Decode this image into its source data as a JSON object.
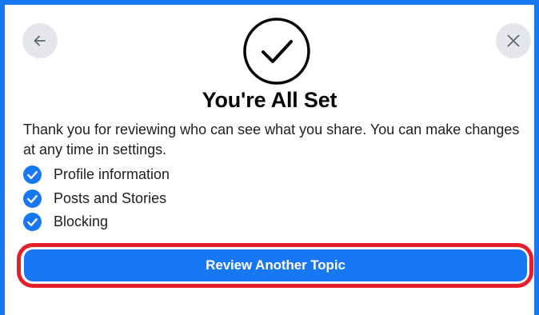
{
  "dialog": {
    "title": "You're All Set",
    "description": "Thank you for reviewing who can see what you share. You can make changes at any time in settings.",
    "icons": {
      "back": "back-arrow-icon",
      "close": "close-icon",
      "success": "checkmark-circle-icon",
      "item_check": "blue-check-circle-icon"
    },
    "reviewed_items": [
      {
        "label": "Profile information"
      },
      {
        "label": "Posts and Stories"
      },
      {
        "label": "Blocking"
      }
    ],
    "primary_button_label": "Review Another Topic"
  },
  "colors": {
    "accent": "#1877f2",
    "highlight_outline": "#e41e2b",
    "button_bg": "#e4e6eb",
    "text": "#1c1e21"
  }
}
